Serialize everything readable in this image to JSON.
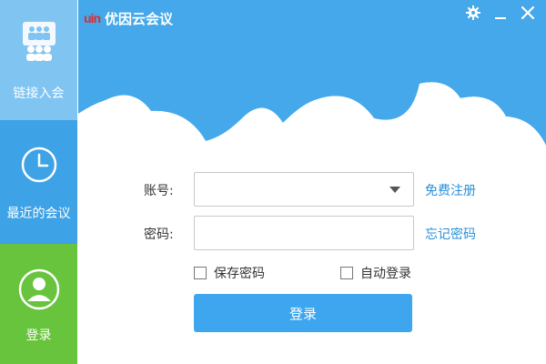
{
  "app": {
    "logo_text": "uin",
    "title": "优因云会议"
  },
  "titlebar": {
    "settings_icon": "gear-icon",
    "minimize_icon": "minimize-icon",
    "close_icon": "close-icon"
  },
  "sidebar": {
    "items": [
      {
        "label": "链接入会",
        "icon": "people-group-icon"
      },
      {
        "label": "最近的会议",
        "icon": "clock-icon"
      },
      {
        "label": "登录",
        "icon": "user-avatar-icon"
      }
    ]
  },
  "form": {
    "account_label": "账号:",
    "account_value": "",
    "password_label": "密码:",
    "password_value": "",
    "register_link": "免费注册",
    "forgot_link": "忘记密码",
    "remember_label": "保存密码",
    "auto_login_label": "自动登录",
    "login_button": "登录"
  },
  "colors": {
    "sky": "#44a8ea",
    "sidebar": "#3ea2e6",
    "sidebar_active_top": "#80c4f2",
    "sidebar_login": "#67c43c",
    "button": "#3ea6ee",
    "link": "#2a8fd8",
    "brand_red": "#e12a2a"
  }
}
